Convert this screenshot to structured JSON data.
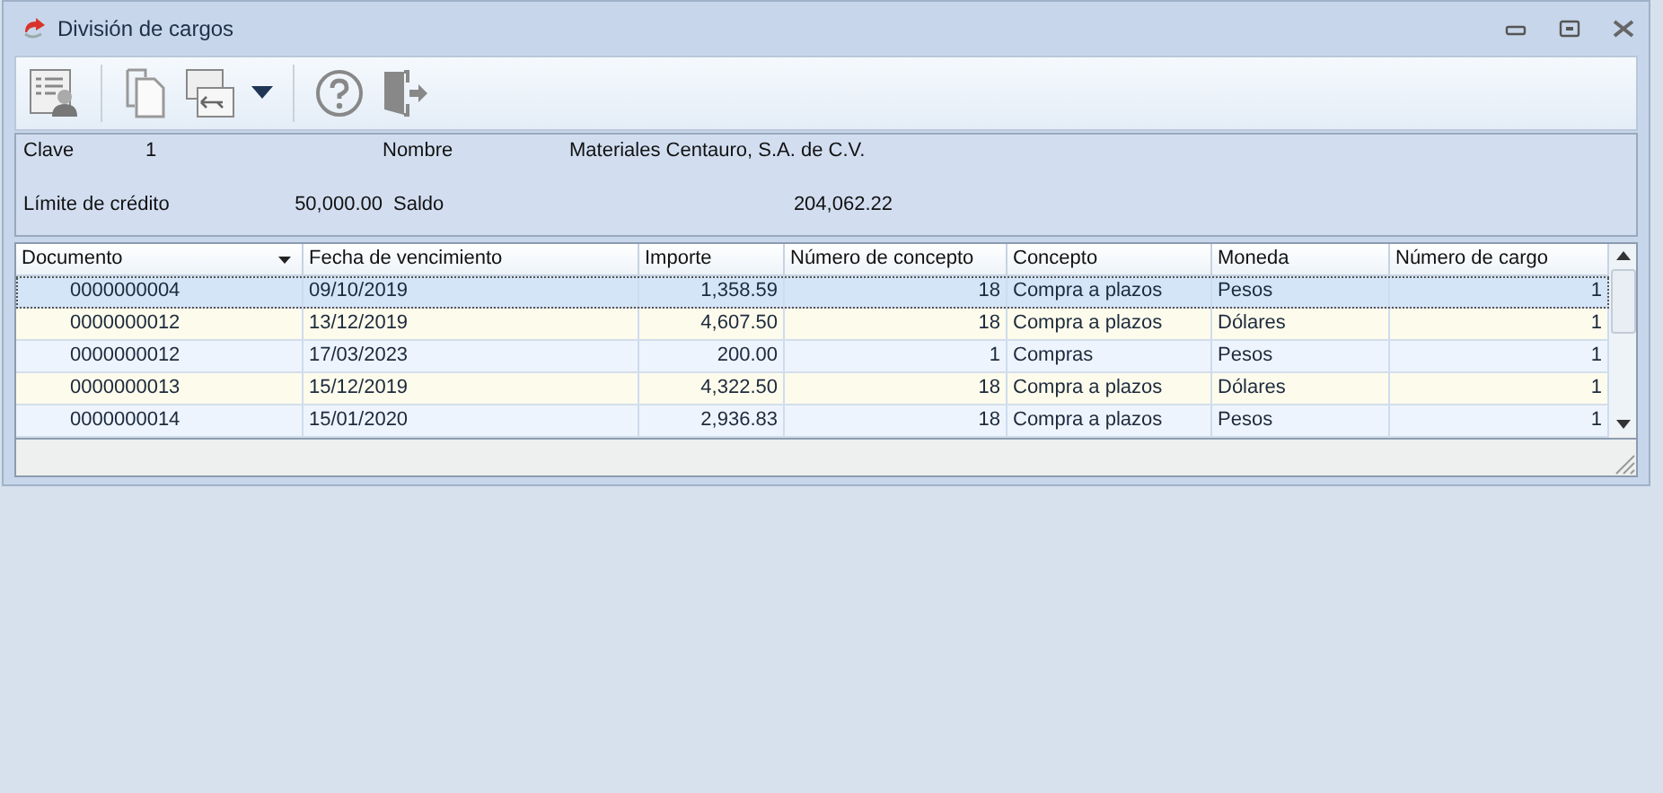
{
  "window": {
    "title": "División de cargos"
  },
  "header": {
    "fields": [
      {
        "label": "Clave",
        "value": "1"
      },
      {
        "label": "Nombre",
        "value": "Materiales Centauro, S.A. de C.V."
      },
      {
        "label": "Límite de crédito",
        "value": "50,000.00"
      },
      {
        "label": "Saldo",
        "value": "204,062.22"
      }
    ]
  },
  "table": {
    "columns": [
      {
        "label": "Documento"
      },
      {
        "label": "Fecha de vencimiento"
      },
      {
        "label": "Importe"
      },
      {
        "label": "Número de concepto"
      },
      {
        "label": "Concepto"
      },
      {
        "label": "Moneda"
      },
      {
        "label": "Número de cargo"
      }
    ],
    "rows": [
      {
        "selected": true,
        "cells": [
          "0000000004",
          "09/10/2019",
          "1,358.59",
          "18",
          "Compra a plazos",
          "Pesos",
          "1"
        ]
      },
      {
        "selected": false,
        "cells": [
          "0000000012",
          "13/12/2019",
          "4,607.50",
          "18",
          "Compra a plazos",
          "Dólares",
          "1"
        ]
      },
      {
        "selected": false,
        "cells": [
          "0000000012",
          "17/03/2023",
          "200.00",
          "1",
          "Compras",
          "Pesos",
          "1"
        ]
      },
      {
        "selected": false,
        "cells": [
          "0000000013",
          "15/12/2019",
          "4,322.50",
          "18",
          "Compra a plazos",
          "Dólares",
          "1"
        ]
      },
      {
        "selected": false,
        "cells": [
          "0000000014",
          "15/01/2020",
          "2,936.83",
          "18",
          "Compra a plazos",
          "Pesos",
          "1"
        ]
      }
    ]
  }
}
